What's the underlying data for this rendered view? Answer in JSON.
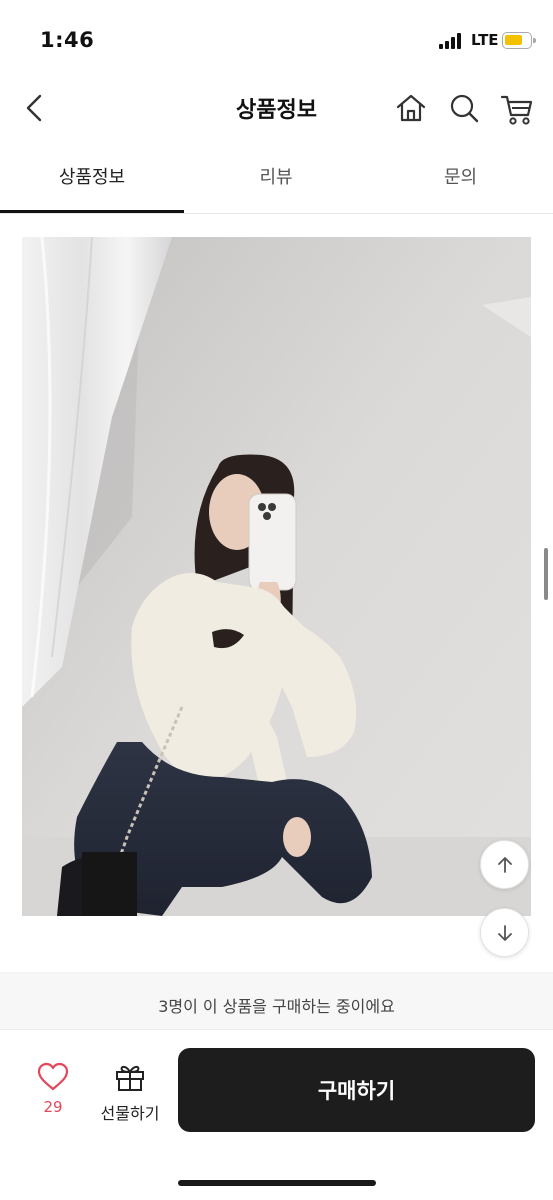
{
  "status_bar": {
    "time": "1:46",
    "network": "LTE",
    "battery_color": "#f2c200"
  },
  "header": {
    "title": "상품정보",
    "icons": [
      "back-chevron-icon",
      "home-icon",
      "search-icon",
      "cart-icon"
    ]
  },
  "tabs": [
    {
      "label": "상품정보",
      "active": true
    },
    {
      "label": "리뷰",
      "active": false
    },
    {
      "label": "문의",
      "active": false
    }
  ],
  "product_image": {
    "subject": "model-white-knit-sweater-dark-jeans"
  },
  "scroll_buttons": [
    "arrow-up-icon",
    "arrow-down-icon"
  ],
  "bottom": {
    "buyers_text": "3명이 이 상품을 구매하는 중이에요",
    "like_count": "29",
    "gift_label": "선물하기",
    "buy_label": "구매하기"
  },
  "colors": {
    "accent_like": "#e4475a",
    "buy_button": "#1d1d1d"
  }
}
